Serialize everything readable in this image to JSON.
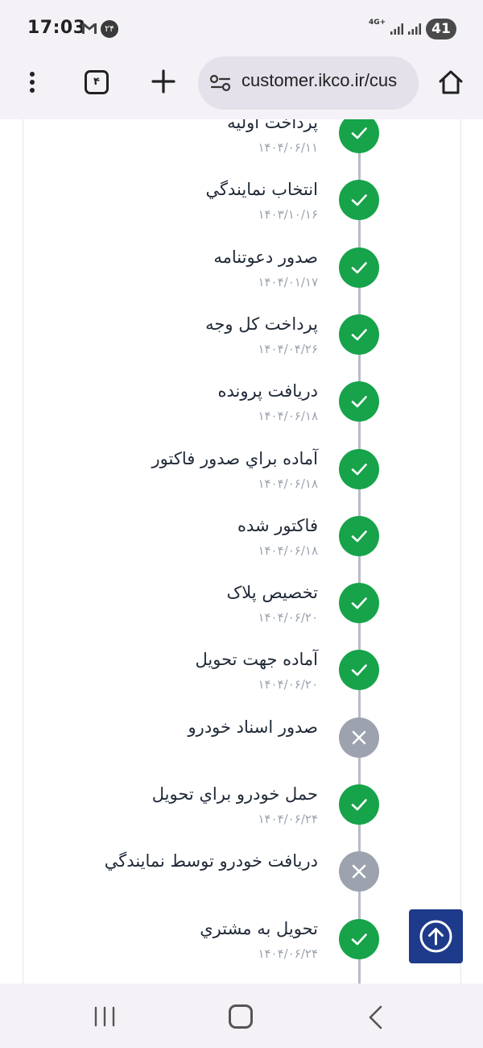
{
  "status_bar": {
    "time": "17:03",
    "notification_badge": "۲۴",
    "network_type": "4G+",
    "battery_level": "41"
  },
  "browser": {
    "tab_count": "۴",
    "url": "customer.ikco.ir/cus"
  },
  "timeline": {
    "steps": [
      {
        "title": "پرداخت اوليه",
        "date": "۱۴۰۴/۰۶/۱۱",
        "status": "done"
      },
      {
        "title": "انتخاب نمايندگي",
        "date": "۱۴۰۳/۱۰/۱۶",
        "status": "done"
      },
      {
        "title": "صدور دعوتنامه",
        "date": "۱۴۰۴/۰۱/۱۷",
        "status": "done"
      },
      {
        "title": "پرداخت كل وجه",
        "date": "۱۴۰۴/۰۴/۲۶",
        "status": "done"
      },
      {
        "title": "دريافت پرونده",
        "date": "۱۴۰۴/۰۶/۱۸",
        "status": "done"
      },
      {
        "title": "آماده براي صدور فاكتور",
        "date": "۱۴۰۴/۰۶/۱۸",
        "status": "done"
      },
      {
        "title": "فاكتور شده",
        "date": "۱۴۰۴/۰۶/۱۸",
        "status": "done"
      },
      {
        "title": "تخصيص پلاک",
        "date": "۱۴۰۴/۰۶/۲۰",
        "status": "done"
      },
      {
        "title": "آماده جهت تحويل",
        "date": "۱۴۰۴/۰۶/۲۰",
        "status": "done"
      },
      {
        "title": "صدور اسناد خودرو",
        "date": "",
        "status": "pending"
      },
      {
        "title": "حمل خودرو براي تحويل",
        "date": "۱۴۰۴/۰۶/۲۴",
        "status": "done"
      },
      {
        "title": "دريافت خودرو توسط نمايندگي",
        "date": "",
        "status": "pending"
      },
      {
        "title": "تحويل به مشتري",
        "date": "۱۴۰۴/۰۶/۲۴",
        "status": "done"
      }
    ]
  },
  "colors": {
    "done": "#16a34a",
    "pending": "#9ca3af",
    "scroll_button": "#1e3a8a"
  },
  "icons": {
    "done": "check-icon",
    "pending": "close-icon",
    "scroll_top": "arrow-up-circle-icon"
  }
}
